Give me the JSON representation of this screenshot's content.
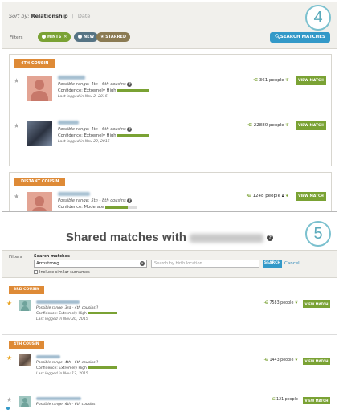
{
  "steps": {
    "step4": "4",
    "step5": "5"
  },
  "panel4": {
    "sort": {
      "prefix": "Sort by:",
      "active": "Relationship",
      "separator": "|",
      "alternate": "Date"
    },
    "filters_label": "Filters",
    "chips": {
      "hints": "HINTS",
      "new": "NEW",
      "starred": "STARRED"
    },
    "search_button": "SEARCH MATCHES",
    "groups": [
      {
        "label": "4TH COUSIN",
        "matches": [
          {
            "range": "Possible range: 4th - 6th cousins",
            "confidence": "Confidence: Extremely High",
            "date": "Last logged in Nov 2, 2015",
            "shared": "361 people",
            "view": "VIEW MATCH"
          },
          {
            "range": "Possible range: 4th - 6th cousins",
            "confidence": "Confidence: Extremely High",
            "date": "Last logged in Nov 22, 2015",
            "shared": "22880 people",
            "view": "VIEW MATCH"
          }
        ]
      },
      {
        "label": "DISTANT COUSIN",
        "matches": [
          {
            "range": "Possible range: 5th - 8th cousins",
            "confidence": "Confidence: Moderate",
            "shared": "1248 people",
            "view": "VIEW MATCH"
          }
        ]
      }
    ]
  },
  "panel5": {
    "title": "Shared matches with",
    "filters_label": "Filters",
    "search_label": "Search matches",
    "search_value": "Armstrong",
    "birth_placeholder": "Search by birth location",
    "search_button": "SEARCH",
    "cancel": "Cancel",
    "include_label": "Include similar surnames",
    "rows": [
      {
        "group": "3RD COUSIN",
        "range": "Possible range: 3rd - 4th cousins",
        "confidence": "Confidence: Extremely High",
        "date": "Last logged in Nov 20, 2015",
        "shared": "7583 people",
        "view": "VIEW MATCH"
      },
      {
        "group": "4TH COUSIN",
        "range": "Possible range: 4th - 6th cousins",
        "confidence": "Confidence: Extremely High",
        "date": "Last logged in Nov 12, 2015",
        "shared": "1443 people",
        "view": "VIEW MATCH"
      },
      {
        "range": "Possible range: 4th - 6th cousins",
        "shared": "121 people",
        "view": "VIEW MATCH"
      }
    ]
  }
}
